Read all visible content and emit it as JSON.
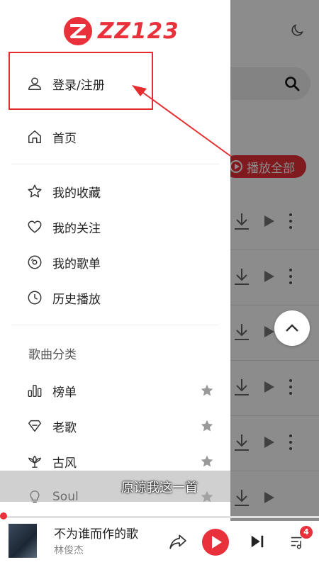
{
  "drawer": {
    "logo_text": "ZZ123",
    "login_label": "登录/注册",
    "nav": {
      "home": "首页",
      "favorites": "我的收藏",
      "following": "我的关注",
      "playlists": "我的歌单",
      "history": "历史播放"
    },
    "section_title": "歌曲分类",
    "categories": {
      "charts": "榜单",
      "oldies": "老歌",
      "guofeng": "古风",
      "soul": "Soul"
    }
  },
  "background": {
    "play_all_label": "播放全部"
  },
  "subtitle": "原谅我这一首",
  "player": {
    "song_title": "不为谁而作的歌",
    "artist": "林俊杰",
    "queue_count": "4"
  },
  "colors": {
    "brand": "#e8313a",
    "annotation": "#e52d2d"
  }
}
